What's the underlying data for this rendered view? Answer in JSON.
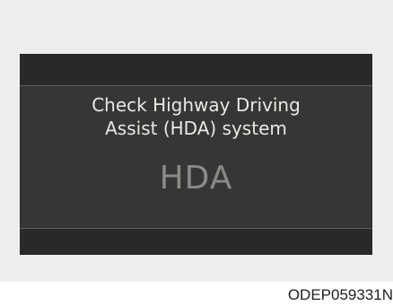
{
  "cluster_display": {
    "message_line1": "Check Highway Driving",
    "message_line2": "Assist (HDA) system",
    "feature_label": "HDA"
  },
  "figure_code": "ODEP059331N",
  "colors": {
    "panel_background": "#eeeeee",
    "screen_background": "#363634",
    "screen_band": "#292927",
    "message_text": "#e8e8e6",
    "feature_label_text": "#8a8a88"
  }
}
